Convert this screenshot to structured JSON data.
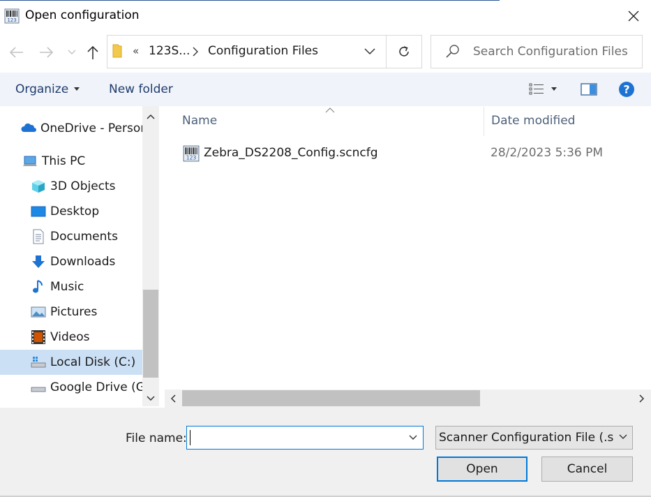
{
  "window": {
    "title": "Open configuration",
    "close_label": "✕"
  },
  "nav": {
    "back_icon": "arrow-left-icon",
    "forward_icon": "arrow-right-icon",
    "up_icon": "arrow-up-icon"
  },
  "address": {
    "overflow": "«",
    "crumbs": [
      "123S...",
      "Configuration Files"
    ]
  },
  "search": {
    "placeholder": "Search Configuration Files"
  },
  "toolbar": {
    "organize_label": "Organize",
    "new_folder_label": "New folder",
    "help_label": "?"
  },
  "sidebar": {
    "items": [
      {
        "label": "OneDrive - Person",
        "icon": "cloud-icon"
      },
      {
        "label": "This PC",
        "icon": "computer-icon"
      },
      {
        "label": "3D Objects",
        "icon": "cube-icon"
      },
      {
        "label": "Desktop",
        "icon": "desktop-icon"
      },
      {
        "label": "Documents",
        "icon": "document-icon"
      },
      {
        "label": "Downloads",
        "icon": "download-arrow-icon"
      },
      {
        "label": "Music",
        "icon": "music-note-icon"
      },
      {
        "label": "Pictures",
        "icon": "picture-icon"
      },
      {
        "label": "Videos",
        "icon": "film-icon"
      },
      {
        "label": "Local Disk (C:)",
        "icon": "drive-icon"
      },
      {
        "label": "Google Drive (G:)",
        "icon": "drive-icon"
      }
    ],
    "selected_index": 9
  },
  "files": {
    "columns": {
      "name": "Name",
      "date": "Date modified"
    },
    "rows": [
      {
        "name": "Zebra_DS2208_Config.scncfg",
        "date": "28/2/2023 5:36 PM"
      }
    ]
  },
  "bottom": {
    "filename_label": "File name:",
    "filename_value": "",
    "filetype_selected": "Scanner Configuration File (.scncfg)",
    "open_label": "Open",
    "cancel_label": "Cancel"
  },
  "colors": {
    "accent": "#0078d7",
    "toolbar_bg": "#f0f3f9",
    "selected_bg": "#cce0f5",
    "help_blue": "#1e73d2"
  }
}
